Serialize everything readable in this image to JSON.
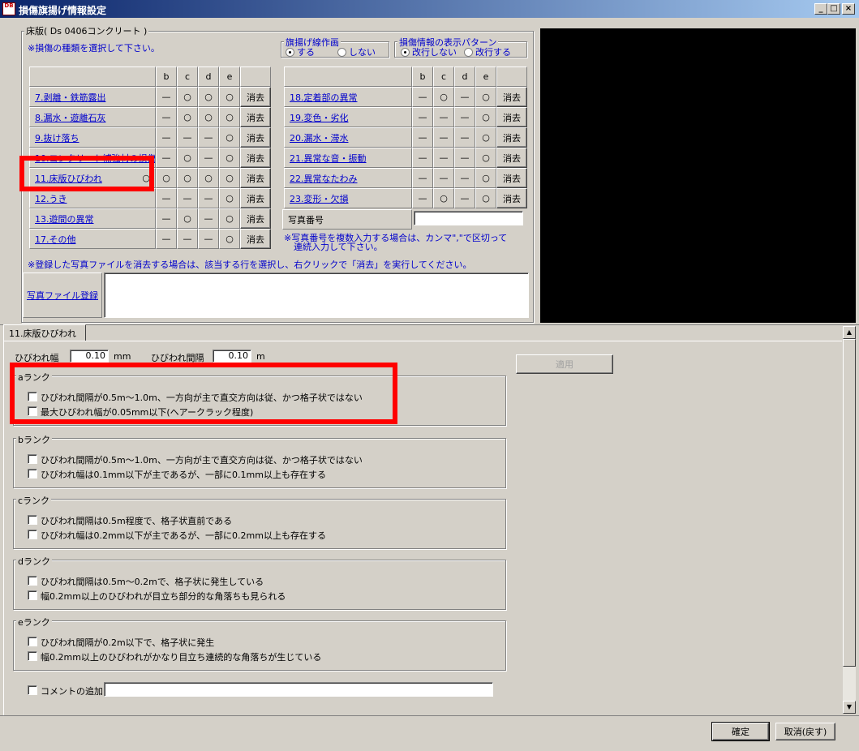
{
  "window": {
    "title": "損傷旗揚げ情報設定",
    "app_icon_text": "DB"
  },
  "top": {
    "group_title": "床版( Ds 0406コンクリート )",
    "instruction": "※損傷の種類を選択して下さい。",
    "flag_group": {
      "title": "旗揚げ線作画",
      "opt_yes": "する",
      "opt_no": "しない",
      "selected": "yes"
    },
    "pattern_group": {
      "title": "損傷情報の表示パターン",
      "opt_a": "改行しない",
      "opt_b": "改行する",
      "selected": "a"
    },
    "col_headers": [
      "b",
      "c",
      "d",
      "e"
    ],
    "clear_label": "消去",
    "left_rows": [
      {
        "label": "7.剥離・鉄筋露出",
        "marks": [
          "—",
          "○",
          "○",
          "○"
        ]
      },
      {
        "label": "8.漏水・遊離石灰",
        "marks": [
          "—",
          "○",
          "○",
          "○"
        ]
      },
      {
        "label": "9.抜け落ち",
        "marks": [
          "—",
          "—",
          "—",
          "○"
        ]
      },
      {
        "label": "10.コンクリート補強材の損傷",
        "marks": [
          "—",
          "○",
          "—",
          "○"
        ]
      },
      {
        "label": "11.床版ひびわれ",
        "marks": [
          "○",
          "○",
          "○",
          "○"
        ],
        "extra": "○"
      },
      {
        "label": "12.うき",
        "marks": [
          "—",
          "—",
          "—",
          "○"
        ]
      },
      {
        "label": "13.遊間の異常",
        "marks": [
          "—",
          "○",
          "—",
          "○"
        ]
      },
      {
        "label": "17.その他",
        "marks": [
          "—",
          "—",
          "—",
          "○"
        ]
      }
    ],
    "right_rows": [
      {
        "label": "18.定着部の異常",
        "marks": [
          "—",
          "○",
          "—",
          "○"
        ]
      },
      {
        "label": "19.変色・劣化",
        "marks": [
          "—",
          "—",
          "—",
          "○"
        ]
      },
      {
        "label": "20.漏水・滞水",
        "marks": [
          "—",
          "—",
          "—",
          "○"
        ]
      },
      {
        "label": "21.異常な音・振動",
        "marks": [
          "—",
          "—",
          "—",
          "○"
        ]
      },
      {
        "label": "22.異常なたわみ",
        "marks": [
          "—",
          "—",
          "—",
          "○"
        ]
      },
      {
        "label": "23.変形・欠損",
        "marks": [
          "—",
          "○",
          "—",
          "○"
        ]
      }
    ],
    "photo_no_label": "写真番号",
    "photo_no_value": "",
    "photo_note_1": "※写真番号を複数入力する場合は、カンマ\",\"で区切って",
    "photo_note_2": "連続入力して下さい。",
    "delete_note": "※登録した写真ファイルを消去する場合は、該当する行を選択し、右クリックで「消去」を実行してください。",
    "photo_register_link": "写真ファイル登録"
  },
  "detail": {
    "tab_label": "11.床版ひびわれ",
    "width_label": "ひびわれ幅",
    "width_value": "0.10",
    "width_unit": "mm",
    "spacing_label": "ひびわれ間隔",
    "spacing_value": "0.10",
    "spacing_unit": "m",
    "apply_label": "適用",
    "ranks": [
      {
        "title": "aランク",
        "items": [
          "ひびわれ間隔が0.5m～1.0m、一方向が主で直交方向は従、かつ格子状ではない",
          "最大ひびわれ幅が0.05mm以下(ヘアークラック程度)"
        ]
      },
      {
        "title": "bランク",
        "items": [
          "ひびわれ間隔が0.5m～1.0m、一方向が主で直交方向は従、かつ格子状ではない",
          "ひびわれ幅は0.1mm以下が主であるが、一部に0.1mm以上も存在する"
        ]
      },
      {
        "title": "cランク",
        "items": [
          "ひびわれ間隔は0.5m程度で、格子状直前である",
          "ひびわれ幅は0.2mm以下が主であるが、一部に0.2mm以上も存在する"
        ]
      },
      {
        "title": "dランク",
        "items": [
          "ひびわれ間隔は0.5m～0.2mで、格子状に発生している",
          "幅0.2mm以上のひびわれが目立ち部分的な角落ちも見られる"
        ]
      },
      {
        "title": "eランク",
        "items": [
          "ひびわれ間隔が0.2m以下で、格子状に発生",
          "幅0.2mm以上のひびわれがかなり目立ち連続的な角落ちが生じている"
        ]
      }
    ],
    "comment_label": "コメントの追加",
    "comment_value": ""
  },
  "footer": {
    "ok_label": "確定",
    "cancel_label": "取消(戻す)"
  },
  "colors": {
    "annotation": "#ff0000",
    "link": "#0000cc",
    "preview_bg": "#000000"
  }
}
